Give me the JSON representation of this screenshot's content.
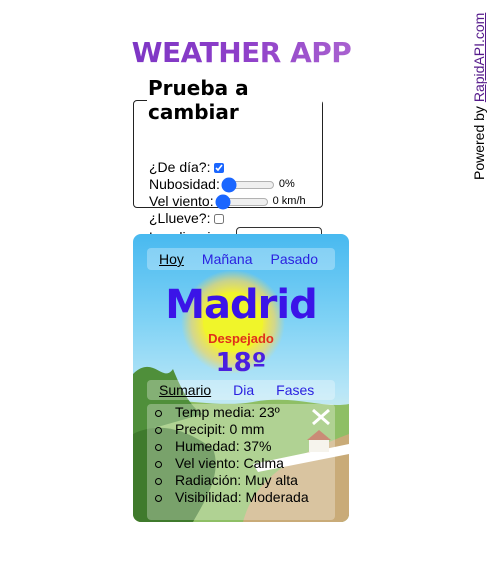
{
  "header": {
    "title": "WEATHER APP"
  },
  "powered": {
    "prefix": "Powered by ",
    "link": "RapidAPI.com"
  },
  "controls": {
    "legend": "Prueba a cambiar",
    "daytime_label": "¿De día?:",
    "daytime_checked": true,
    "cloudiness_label": "Nubosidad:",
    "cloudiness_value": "0%",
    "wind_label": "Vel viento:",
    "wind_value": "0 km/h",
    "rain_label": "¿Llueve?:",
    "rain_checked": false,
    "location_label": "Localizacion:",
    "location_value": ""
  },
  "weather": {
    "tabs": [
      "Hoy",
      "Mañana",
      "Pasado"
    ],
    "active_tab": "Hoy",
    "city": "Madrid",
    "condition": "Despejado",
    "temperature": "18º",
    "detail_tabs": [
      "Sumario",
      "Dia",
      "Fases"
    ],
    "active_detail_tab": "Sumario",
    "details": [
      "Temp media: 23º",
      "Precipit: 0 mm",
      "Humedad: 37%",
      "Vel viento: Calma",
      "Radiación: Muy alta",
      "Visibilidad: Moderada"
    ]
  },
  "colors": {
    "title_gradient_start": "#6a2bbf",
    "city": "#3b14e8",
    "condition": "#e0301a",
    "tab_link": "#2a1fe0",
    "sun": "#f2f52a"
  }
}
